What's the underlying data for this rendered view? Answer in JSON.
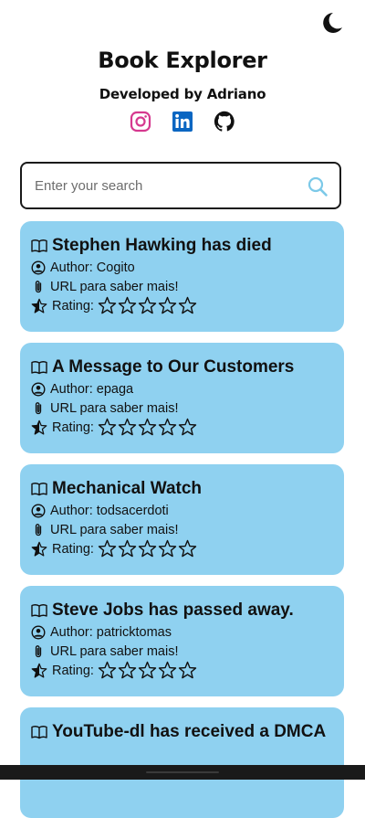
{
  "header": {
    "title": "Book Explorer",
    "subtitle": "Developed by Adriano",
    "socials": [
      "instagram-icon",
      "linkedin-icon",
      "github-icon"
    ]
  },
  "theme_toggle": {
    "icon": "moon-icon"
  },
  "search": {
    "placeholder": "Enter your search",
    "value": ""
  },
  "colors": {
    "card_bg": "#8fd1f0",
    "search_icon": "#7cc9e8",
    "instagram": "#d6398f",
    "linkedin": "#0a66c2"
  },
  "cards": [
    {
      "title": "Stephen Hawking has died",
      "author": "Author: Cogito",
      "url_label": "URL para saber mais!",
      "rating_label": "Rating:",
      "rating": 0,
      "max_rating": 5
    },
    {
      "title": "A Message to Our Customers",
      "author": "Author: epaga",
      "url_label": "URL para saber mais!",
      "rating_label": "Rating:",
      "rating": 0,
      "max_rating": 5
    },
    {
      "title": "Mechanical Watch",
      "author": "Author: todsacerdoti",
      "url_label": "URL para saber mais!",
      "rating_label": "Rating:",
      "rating": 0,
      "max_rating": 5
    },
    {
      "title": "Steve Jobs has passed away.",
      "author": "Author: patricktomas",
      "url_label": "URL para saber mais!",
      "rating_label": "Rating:",
      "rating": 0,
      "max_rating": 5
    },
    {
      "title": "YouTube-dl has received a DMCA",
      "author": "",
      "url_label": "",
      "rating_label": "",
      "rating": 0,
      "max_rating": 5
    }
  ]
}
